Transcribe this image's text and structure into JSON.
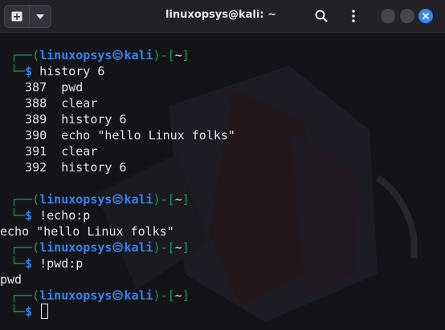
{
  "window": {
    "title": "linuxopsys@kali: ~",
    "icons": [
      "new-tab-icon",
      "dropdown-icon",
      "search-icon",
      "menu-icon",
      "minimize-icon",
      "maximize-icon",
      "close-icon"
    ]
  },
  "prompt": {
    "user": "linuxopsys",
    "host": "kali",
    "dir": "~",
    "symbol": "$",
    "colors": {
      "bracket": "#18a05c",
      "user": "#3a83f0",
      "dollar": "#3a83f0"
    }
  },
  "blocks": [
    {
      "command": "history 6",
      "output": [
        "  387  pwd",
        "  388  clear",
        "  389  history 6",
        "  390  echo \"hello Linux folks\"",
        "  391  clear",
        "  392  history 6"
      ]
    },
    {
      "command": "!echo:p",
      "output": [
        "echo \"hello Linux folks\""
      ]
    },
    {
      "command": "!pwd:p",
      "output": [
        "pwd"
      ]
    },
    {
      "command": "",
      "output": []
    }
  ]
}
